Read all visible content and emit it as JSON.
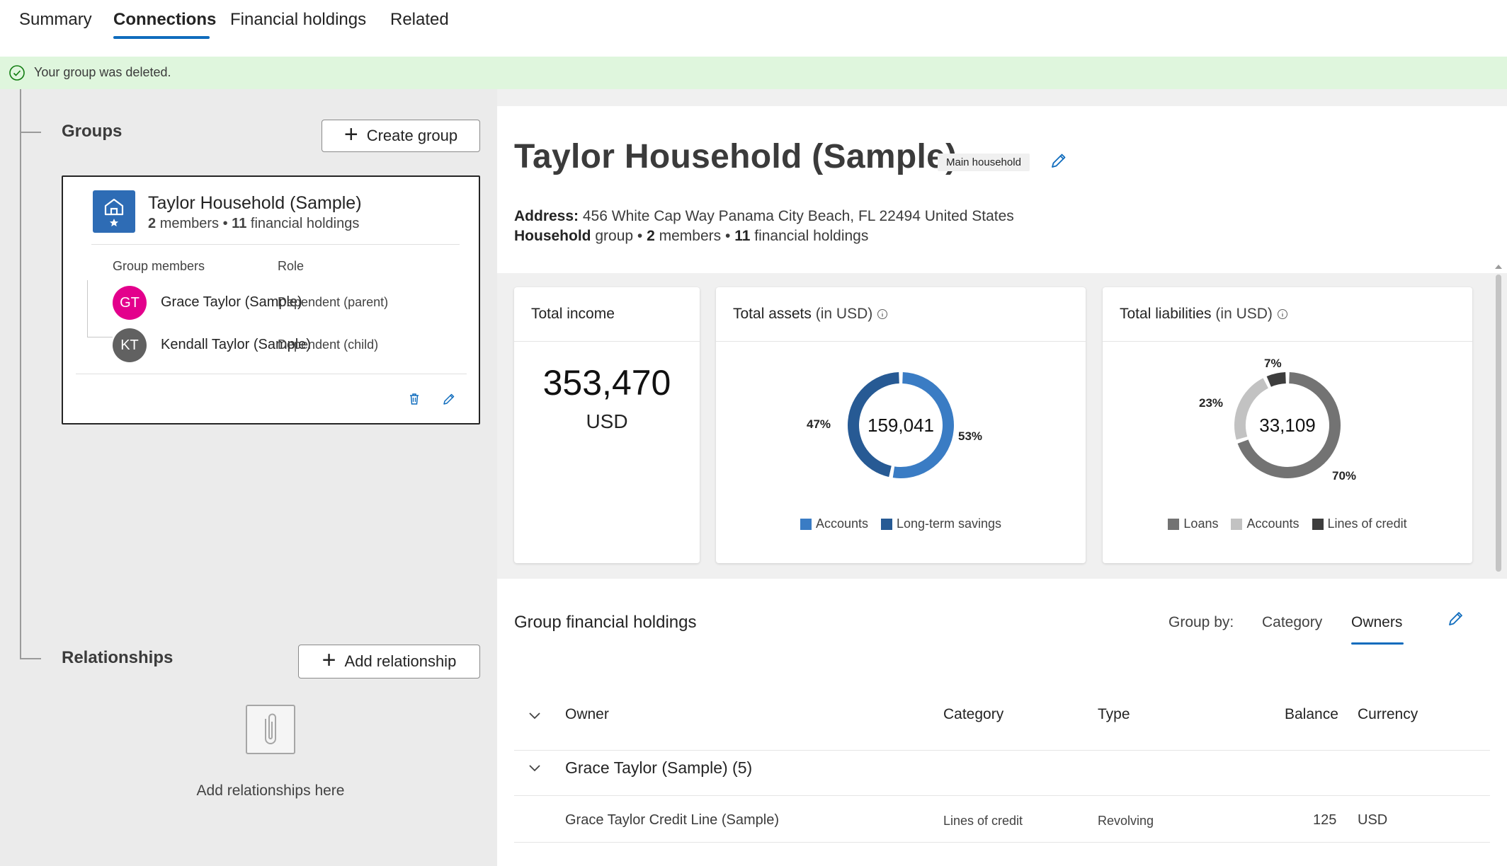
{
  "tabs": [
    {
      "label": "Summary"
    },
    {
      "label": "Connections"
    },
    {
      "label": "Financial holdings"
    },
    {
      "label": "Related"
    }
  ],
  "banner": {
    "text": "Your group was deleted."
  },
  "groups": {
    "title": "Groups",
    "create_label": "Create group",
    "card": {
      "name": "Taylor Household (Sample)",
      "members_count": "2",
      "members_text": "members",
      "holdings_count": "11",
      "holdings_text": "financial holdings",
      "col_members": "Group members",
      "col_role": "Role",
      "members": [
        {
          "initials": "GT",
          "name": "Grace Taylor (Sample)",
          "role": "Dependent (parent)",
          "color": "#e3008c"
        },
        {
          "initials": "KT",
          "name": "Kendall Taylor (Sample)",
          "role": "Dependent (child)",
          "color": "#616161"
        }
      ]
    }
  },
  "relationships": {
    "title": "Relationships",
    "add_label": "Add relationship",
    "empty_text": "Add relationships here"
  },
  "household": {
    "title": "Taylor Household (Sample)",
    "badge": "Main household",
    "address_label": "Address:",
    "address": "456 White Cap Way Panama City Beach, FL 22494 United States",
    "group_type": "Household",
    "group_word": "group",
    "members_count": "2",
    "members_text": "members",
    "holdings_count": "11",
    "holdings_text": "financial holdings"
  },
  "metrics": {
    "income": {
      "title": "Total income",
      "value": "353,470",
      "currency": "USD"
    },
    "assets": {
      "title": "Total assets",
      "unit": "(in USD)",
      "total": "159,041",
      "segments": [
        {
          "label": "Accounts",
          "pct": 53,
          "pct_label": "53%",
          "color": "#3a7cc4"
        },
        {
          "label": "Long-term savings",
          "pct": 47,
          "pct_label": "47%",
          "color": "#275a94"
        }
      ]
    },
    "liabilities": {
      "title": "Total liabilities",
      "unit": "(in USD)",
      "total": "33,109",
      "segments": [
        {
          "label": "Loans",
          "pct": 70,
          "pct_label": "70%",
          "color": "#737373"
        },
        {
          "label": "Accounts",
          "pct": 23,
          "pct_label": "23%",
          "color": "#c2c2c2"
        },
        {
          "label": "Lines of credit",
          "pct": 7,
          "pct_label": "7%",
          "color": "#3d3d3d"
        }
      ]
    }
  },
  "holdings": {
    "title": "Group financial holdings",
    "group_by_label": "Group by:",
    "group_by_options": [
      "Category",
      "Owners"
    ],
    "selected": "Owners",
    "columns": {
      "owner": "Owner",
      "category": "Category",
      "type": "Type",
      "balance": "Balance",
      "currency": "Currency"
    },
    "group_row": "Grace Taylor (Sample) (5)",
    "rows": [
      {
        "name": "Grace Taylor Credit Line (Sample)",
        "category": "Lines of credit",
        "type": "Revolving",
        "balance": "125",
        "currency": "USD"
      }
    ]
  }
}
